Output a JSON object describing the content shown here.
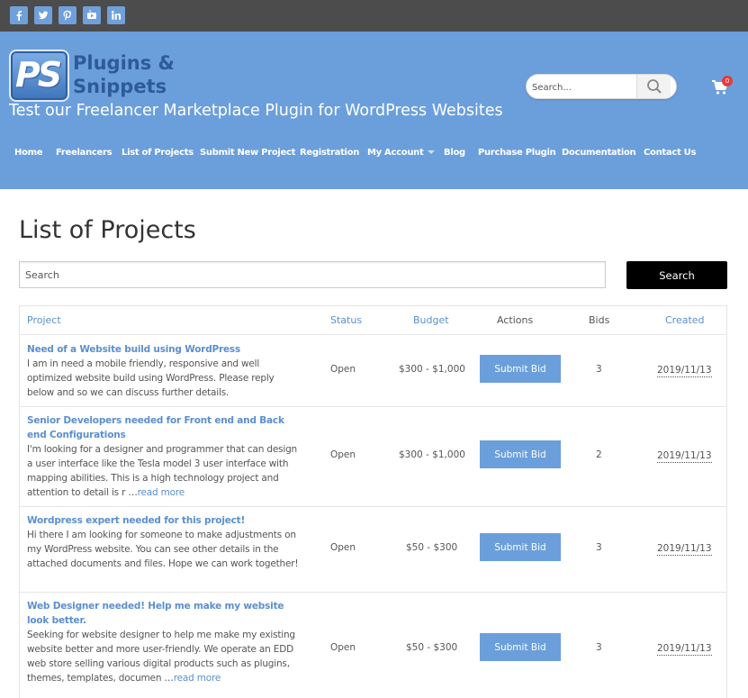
{
  "social": {
    "facebook": "f",
    "twitter": "t",
    "pinterest": "p",
    "youtube": "You",
    "linkedin": "in"
  },
  "header": {
    "logo_mark": "PS",
    "logo_line1": "Plugins &",
    "logo_line2": "Snippets",
    "tagline": "Test our Freelancer Marketplace Plugin for WordPress Websites",
    "search_placeholder": "Search...",
    "cart_count": "0"
  },
  "nav": {
    "items": [
      "Home",
      "Freelancers",
      "List of Projects",
      "Submit New Project",
      "Registration",
      "My Account",
      "Blog",
      "Purchase Plugin",
      "Documentation",
      "Contact Us"
    ]
  },
  "main": {
    "title": "List of Projects",
    "search_placeholder": "Search",
    "search_button": "Search"
  },
  "table": {
    "headers": {
      "project": "Project",
      "status": "Status",
      "budget": "Budget",
      "actions": "Actions",
      "bids": "Bids",
      "created": "Created"
    },
    "rows": [
      {
        "title": "Need of a Website build using WordPress",
        "description": "I am in need a mobile friendly, responsive and well optimized website build using WordPress. Please reply below and so we can discuss further details.",
        "read_more": "",
        "status": "Open",
        "budget": "$300 - $1,000",
        "action": "Submit Bid",
        "bids": "3",
        "created": "2019/11/13"
      },
      {
        "title": "Senior Developers needed for Front end and Back end Configurations",
        "description": "I'm looking for a designer and programmer that can design a user interface like the Tesla model 3 user interface with mapping abilities. This is a high technology project and attention to detail is r …",
        "read_more": "read more",
        "status": "Open",
        "budget": "$300 - $1,000",
        "action": "Submit Bid",
        "bids": "2",
        "created": "2019/11/13"
      },
      {
        "title": "Wordpress expert needed for this project!",
        "description": "Hi there I am looking for someone to make adjustments on my WordPress website. You can see other details in the attached documents and files. Hope we can work together!",
        "read_more": "",
        "status": "Open",
        "budget": "$50 - $300",
        "action": "Submit Bid",
        "bids": "3",
        "created": "2019/11/13"
      },
      {
        "title": "Web Designer needed! Help me make my website look better.",
        "description": "Seeking for website designer to help me make my existing website better and more user-friendly. We operate an EDD web store selling various digital products such as plugins, themes, templates, documen …",
        "read_more": "read more",
        "status": "Open",
        "budget": "$50 - $300",
        "action": "Submit Bid",
        "bids": "3",
        "created": "2019/11/13"
      }
    ]
  }
}
